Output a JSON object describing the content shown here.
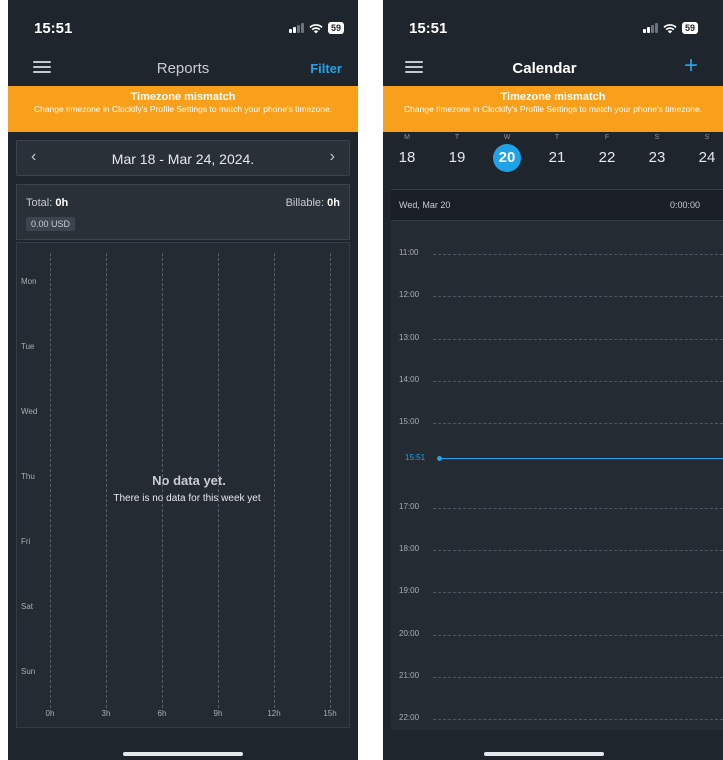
{
  "left": {
    "status": {
      "time": "15:51",
      "battery": "59"
    },
    "header": {
      "title": "Reports",
      "filter_label": "Filter"
    },
    "banner": {
      "title": "Timezone mismatch",
      "message": "Change timezone in Clockify's Profile Settings to match your phone's timezone."
    },
    "date_range": "Mar 18 - Mar 24, 2024.",
    "totals": {
      "total_label": "Total:",
      "total_value": "0h",
      "billable_label": "Billable:",
      "billable_value": "0h",
      "amount": "0.00 USD"
    },
    "chart": {
      "days": [
        "Mon",
        "Tue",
        "Wed",
        "Thu",
        "Fri",
        "Sat",
        "Sun"
      ],
      "hours": [
        "0h",
        "3h",
        "6h",
        "9h",
        "12h",
        "15h"
      ],
      "empty_title": "No data yet.",
      "empty_message": "There is no data for this week yet"
    }
  },
  "right": {
    "status": {
      "time": "15:51",
      "battery": "59"
    },
    "header": {
      "title": "Calendar",
      "add_label": "+"
    },
    "banner": {
      "title": "Timezone mismatch",
      "message": "Change timezone in Clockify's Profile Settings to match your phone's timezone."
    },
    "week": [
      {
        "letter": "M",
        "num": "18"
      },
      {
        "letter": "T",
        "num": "19"
      },
      {
        "letter": "W",
        "num": "20",
        "today": true
      },
      {
        "letter": "T",
        "num": "21"
      },
      {
        "letter": "F",
        "num": "22"
      },
      {
        "letter": "S",
        "num": "23"
      },
      {
        "letter": "S",
        "num": "24"
      }
    ],
    "day_header": {
      "date": "Wed, Mar 20",
      "total": "0:00:00"
    },
    "times": [
      "11:00",
      "12:00",
      "13:00",
      "14:00",
      "15:00",
      "16:00",
      "17:00",
      "18:00",
      "19:00",
      "20:00",
      "21:00",
      "22:00"
    ],
    "now": "15:51"
  },
  "colors": {
    "accent": "#1fa3e6",
    "banner": "#f8a01c",
    "background": "#1f252c"
  }
}
